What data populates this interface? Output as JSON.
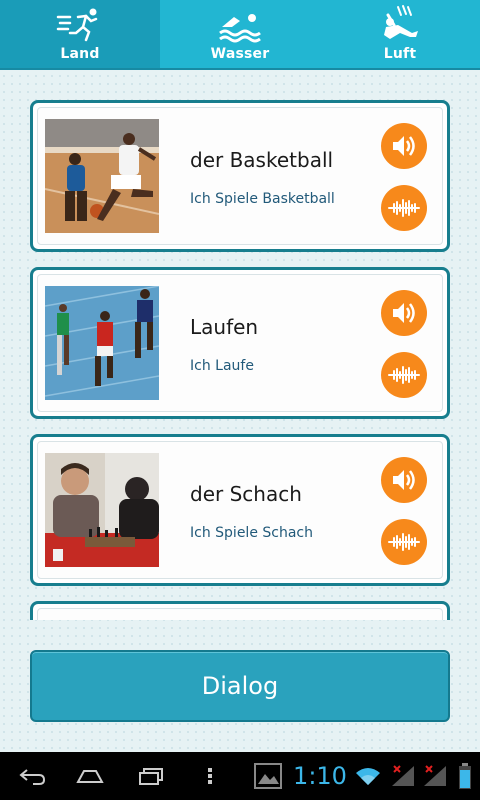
{
  "tabs": [
    {
      "label": "Land",
      "icon": "running-person-icon",
      "active": true
    },
    {
      "label": "Wasser",
      "icon": "swimmer-icon",
      "active": false
    },
    {
      "label": "Luft",
      "icon": "skydiver-icon",
      "active": false
    }
  ],
  "cards": [
    {
      "word": "der Basketball",
      "sentence": "Ich Spiele Basketball",
      "image": "basketball-photo"
    },
    {
      "word": "Laufen",
      "sentence": "Ich Laufe",
      "image": "running-photo"
    },
    {
      "word": "der Schach",
      "sentence": "Ich Spiele Schach",
      "image": "chess-photo"
    }
  ],
  "dialog_button": "Dialog",
  "status": {
    "time": "1:10"
  },
  "colors": {
    "accent": "#1faecb",
    "orange": "#f7891b",
    "border": "#177e8e",
    "link": "#225a7a"
  }
}
